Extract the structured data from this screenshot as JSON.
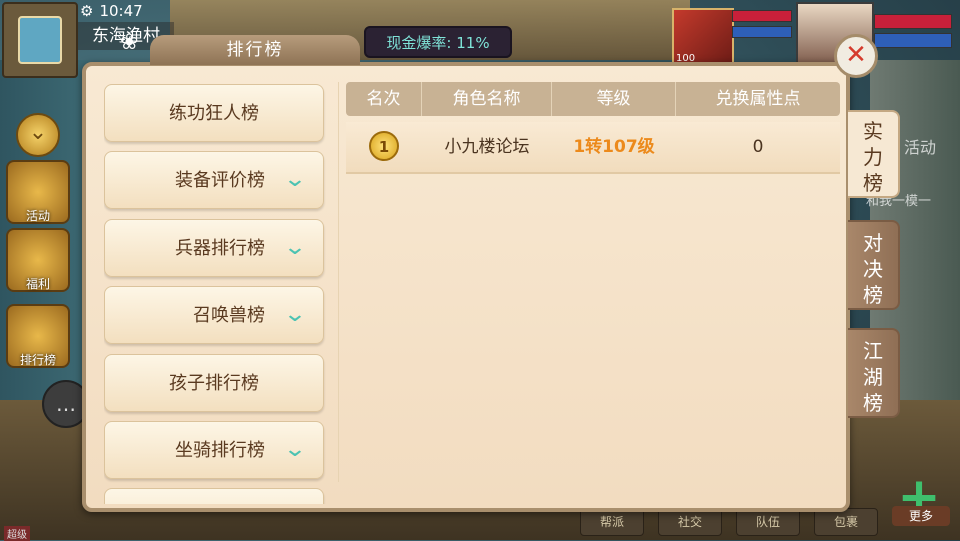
{
  "hud": {
    "time": "10:47",
    "zone": "东海渔村",
    "cash_rate": "现金爆率: 11%",
    "player_level": "100",
    "more_label": "更多",
    "version_tag": "超级",
    "side_items": [
      {
        "label": "活动"
      },
      {
        "label": "福利"
      },
      {
        "label": "排行榜"
      }
    ],
    "bottom_items": [
      "帮派",
      "社交",
      "队伍",
      "包裹"
    ],
    "bg_texts": [
      "活动",
      "和我一模一"
    ]
  },
  "panel": {
    "title": "排行榜"
  },
  "categories": [
    {
      "label": "练功狂人榜",
      "expandable": false
    },
    {
      "label": "装备评价榜",
      "expandable": true
    },
    {
      "label": "兵器排行榜",
      "expandable": true
    },
    {
      "label": "召唤兽榜",
      "expandable": true
    },
    {
      "label": "孩子排行榜",
      "expandable": false
    },
    {
      "label": "坐骑排行榜",
      "expandable": true
    }
  ],
  "table": {
    "columns": [
      "名次",
      "角色名称",
      "等级",
      "兑换属性点"
    ],
    "rows": [
      {
        "rank": "1",
        "name": "小九楼论坛",
        "level": "1转107级",
        "points": "0"
      }
    ]
  },
  "tabs": [
    {
      "label": [
        "实",
        "力",
        "榜"
      ],
      "active": true
    },
    {
      "label": [
        "对",
        "决",
        "榜"
      ],
      "active": false
    },
    {
      "label": [
        "江",
        "湖",
        "榜"
      ],
      "active": false
    }
  ],
  "colors": {
    "accent_arrow": "#4cc3b2",
    "level_text": "#ec8a1c",
    "close_x": "#d53b2d"
  }
}
